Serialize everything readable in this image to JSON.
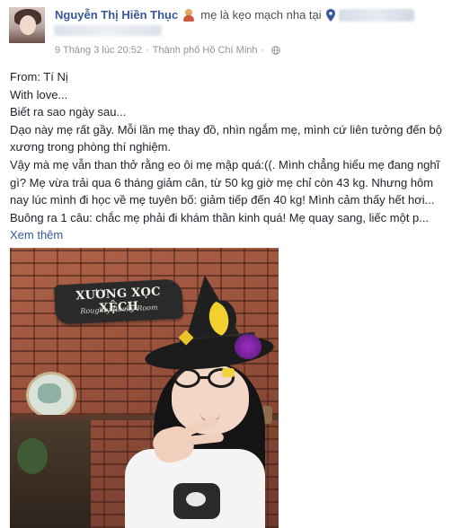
{
  "post": {
    "author_name": "Nguyễn Thị Hiền Thục",
    "status_text": "mẹ là kẹo mạch nha tại",
    "timestamp": "9 Tháng 3 lúc 20:52",
    "meta_separator": "·",
    "location": "Thành phố Hồ Chí Minh",
    "meta_separator_2": "·",
    "icons": {
      "feeling": "person-feeling-icon",
      "location": "map-pin-icon",
      "privacy": "globe-icon"
    },
    "link_color": "#365899",
    "lines": [
      "From: Tí Nị",
      "With love...",
      "Biết ra sao ngày sau...",
      "Dạo này mẹ rất gầy. Mỗi lần mẹ thay đồ, nhìn ngắm mẹ, mình cứ liên tưởng đến bộ xương trong phòng thí nghiệm.",
      "Vậy mà mẹ vẫn than thở rằng eo ôi mẹ mập quá:((. Mình chẳng hiểu mẹ đang nghĩ gì? Mẹ vừa trải qua 6 tháng giảm cân, từ 50 kg giờ mẹ chỉ còn 43 kg. Nhưng hôm nay lúc mình đi học về mẹ tuyên bố: giảm tiếp đến 40 kg! Mình cảm thấy hết hơi... Buông ra 1 câu: chắc mẹ phải đi khám thần kinh quá! Mẹ quay sang, liếc một p..."
    ],
    "see_more": "Xem thêm",
    "photo": {
      "sign_title": "XƯƠNG XỌC XỆCH",
      "sign_subtitle": "Roughly Rocky Room"
    }
  }
}
